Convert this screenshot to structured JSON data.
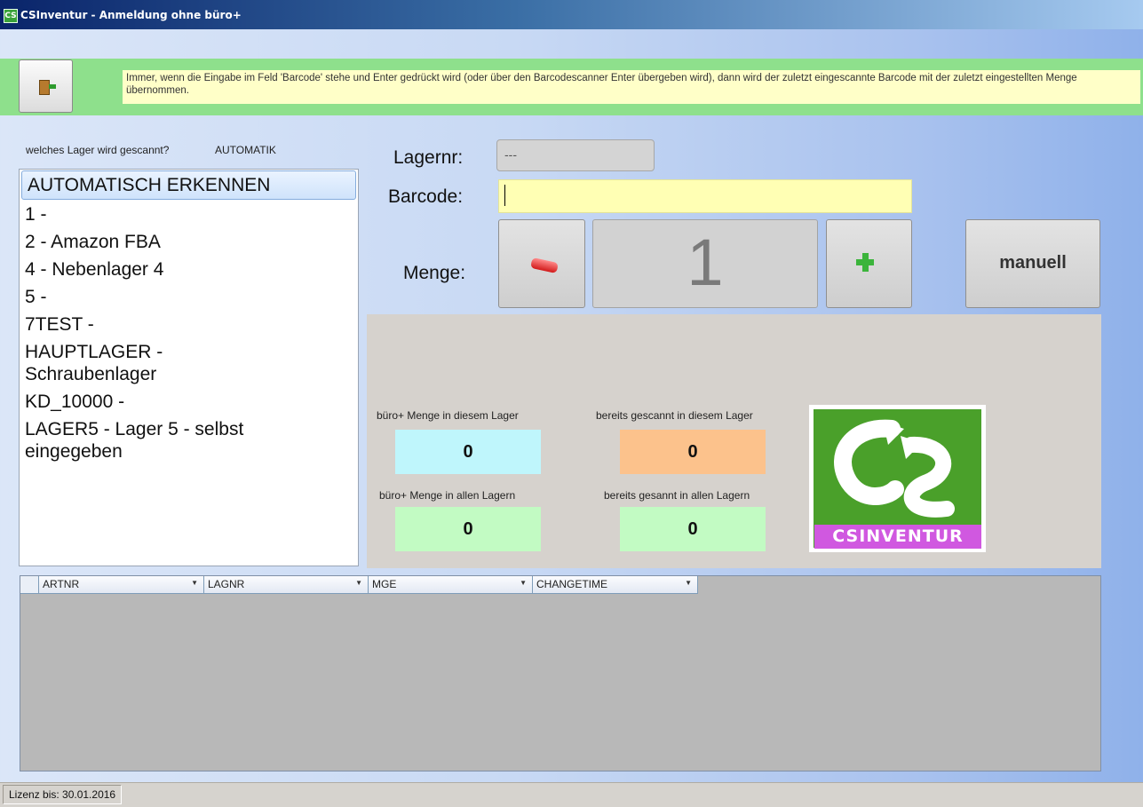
{
  "window": {
    "title": "CSInventur - Anmeldung ohne büro+",
    "icon": "cs-app-icon"
  },
  "info": {
    "exit_icon": "exit-door-icon",
    "text": "Immer, wenn die Eingabe im Feld 'Barcode' stehe und Enter gedrückt wird (oder über den Barcodescanner Enter übergeben wird), dann wird der zuletzt eingescannte Barcode mit der zuletzt eingestellten Menge übernommen."
  },
  "lager": {
    "question": "welches Lager wird gescannt?",
    "mode": "AUTOMATIK",
    "items": [
      "AUTOMATISCH ERKENNEN",
      "1 -",
      "2 - Amazon FBA",
      "4 - Nebenlager 4",
      "5 -",
      "7TEST -",
      "HAUPTLAGER -\nSchraubenlager",
      "KD_10000 -",
      "LAGER5 - Lager 5  - selbst\neingegeben"
    ],
    "selected_index": 0
  },
  "form": {
    "lagernr_label": "Lagernr:",
    "lagernr_value": "---",
    "barcode_label": "Barcode:",
    "barcode_value": "",
    "menge_label": "Menge:",
    "menge_value": "1",
    "minus_icon": "minus-icon",
    "plus_icon": "plus-icon",
    "manuell_label": "manuell"
  },
  "stats": {
    "lager_menge_label": "büro+ Menge in diesem Lager",
    "lager_menge_value": "0",
    "scanned_lager_label": "bereits gescannt in diesem Lager",
    "scanned_lager_value": "0",
    "all_menge_label": "büro+ Menge in allen Lagern",
    "all_menge_value": "0",
    "scanned_all_label": "bereits gesannt in allen Lagern",
    "scanned_all_value": "0",
    "colors": {
      "cyan": "#bff6fc",
      "orange": "#fcc28c",
      "green": "#c2fbc3"
    }
  },
  "logo": {
    "text": "CSInventur",
    "icon": "csinventur-logo",
    "colors": {
      "green": "#4aa02a",
      "magenta": "#d058e0"
    }
  },
  "grid": {
    "columns": [
      "ARTNR",
      "LAGNR",
      "MGE",
      "CHANGETIME"
    ],
    "rows": []
  },
  "status": {
    "license": "Lizenz bis: 30.01.2016"
  }
}
